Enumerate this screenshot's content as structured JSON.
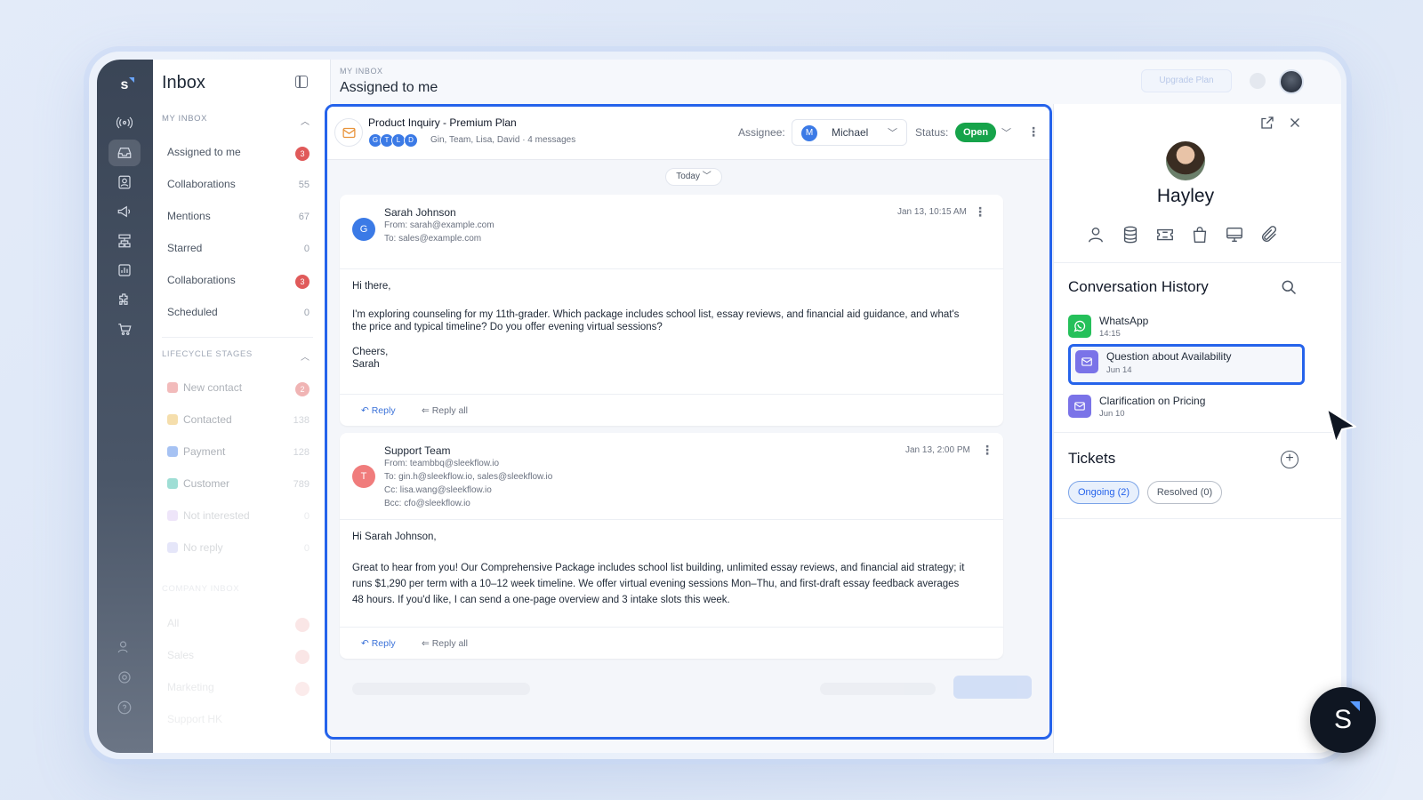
{
  "nav": {
    "title": "Inbox",
    "my_inbox_label": "MY INBOX",
    "my_inbox": [
      {
        "label": "Assigned to me",
        "count": "3",
        "badge": true
      },
      {
        "label": "Collaborations",
        "count": "55",
        "badge": false
      },
      {
        "label": "Mentions",
        "count": "67",
        "badge": false
      },
      {
        "label": "Starred",
        "count": "0",
        "badge": false
      },
      {
        "label": "Collaborations",
        "count": "3",
        "badge": true
      },
      {
        "label": "Scheduled",
        "count": "0",
        "badge": false
      }
    ],
    "lifecycle_label": "LIFECYCLE STAGES",
    "lifecycle": [
      {
        "label": "New contact",
        "count": "2",
        "badge": true,
        "color": "#e46a6a"
      },
      {
        "label": "Contacted",
        "count": "138",
        "badge": false,
        "color": "#eab84a"
      },
      {
        "label": "Payment",
        "count": "128",
        "badge": false,
        "color": "#3b7ae6"
      },
      {
        "label": "Customer",
        "count": "789",
        "badge": false,
        "color": "#2db7a3"
      },
      {
        "label": "Not interested",
        "count": "0",
        "badge": false,
        "color": "#b48be8"
      },
      {
        "label": "No reply",
        "count": "0",
        "badge": false,
        "color": "#8b8fe8"
      }
    ],
    "company_label": "COMPANY INBOX",
    "company": [
      {
        "label": "All"
      },
      {
        "label": "Sales"
      },
      {
        "label": "Marketing"
      },
      {
        "label": "Support HK"
      }
    ]
  },
  "header": {
    "breadcrumb": "MY INBOX",
    "title": "Assigned to me",
    "upgrade_label": "Upgrade Plan"
  },
  "conversation": {
    "subject": "Product Inquiry - Premium Plan",
    "participant_initials": [
      "G",
      "T",
      "L",
      "D"
    ],
    "participants_text": "Gin, Team, Lisa, David · 4 messages",
    "assignee_label": "Assignee:",
    "assignee_initial": "M",
    "assignee_name": "Michael",
    "status_label": "Status:",
    "status_value": "Open",
    "date_divider": "Today"
  },
  "messages": [
    {
      "avatar": "G",
      "avatar_color": "#3b7ae6",
      "sender": "Sarah Johnson",
      "from": "From: sarah@example.com",
      "to": "To: sales@example.com",
      "date": "Jan 13, 10:15 AM",
      "greeting": "Hi there,",
      "body": "I'm exploring counseling for my 11th-grader. Which package includes school list, essay reviews, and financial aid guidance, and what's the price and typical timeline? Do you offer evening virtual sessions?",
      "signoff1": "Cheers,",
      "signoff2": "Sarah",
      "reply": "Reply",
      "reply_all": "Reply all"
    },
    {
      "avatar": "T",
      "avatar_color": "#f07c7c",
      "sender": "Support Team",
      "from": "From: teambbq@sleekflow.io",
      "to": "To: gin.h@sleekflow.io, sales@sleekflow.io",
      "cc": "Cc: lisa.wang@sleekflow.io",
      "bcc": "Bcc: cfo@sleekflow.io",
      "date": "Jan 13, 2:00 PM",
      "greeting": "Hi Sarah Johnson,",
      "body": "Great to hear from you! Our Comprehensive Package includes school list building, unlimited essay reviews, and financial aid strategy; it runs $1,290 per term with a 10–12 week timeline. We offer virtual evening sessions Mon–Thu, and first-draft essay feedback averages 48 hours. If you'd like, I can send a one-page overview and 3 intake slots this week.",
      "reply": "Reply",
      "reply_all": "Reply all"
    }
  ],
  "contact": {
    "name": "Hayley",
    "history_title": "Conversation History",
    "history": [
      {
        "title": "WhatsApp",
        "sub": "14:15",
        "channel": "whatsapp",
        "color": "#25c05a"
      },
      {
        "title": "Question about Availability",
        "sub": "Jun 14",
        "channel": "email",
        "color": "#7a73e8"
      },
      {
        "title": "Clarification on Pricing",
        "sub": "Jun 10",
        "channel": "email",
        "color": "#7a73e8"
      }
    ],
    "tickets_title": "Tickets",
    "tickets_ongoing": "Ongoing (2)",
    "tickets_resolved": "Resolved (0)",
    "tool_icons": [
      "person-icon",
      "database-icon",
      "ticket-icon",
      "bag-icon",
      "monitor-icon",
      "paperclip-icon"
    ]
  },
  "brand": {
    "letter": "S",
    "rail_letter": "s"
  },
  "colors": {
    "accent": "#2563eb",
    "status_open": "#16a34a",
    "badge_red": "#e05a5a"
  }
}
